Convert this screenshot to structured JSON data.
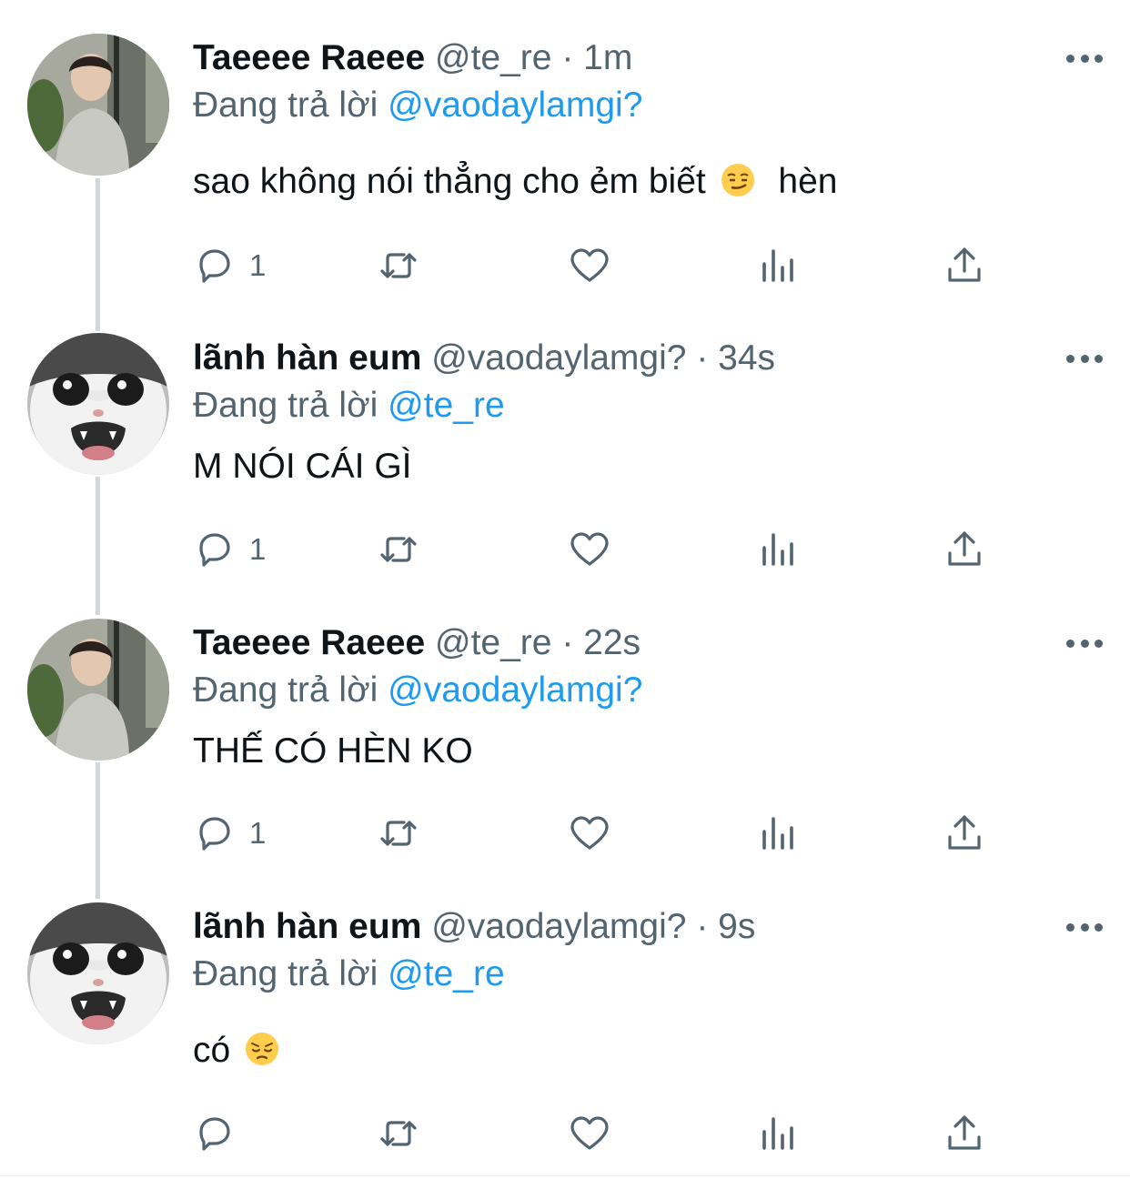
{
  "thread": [
    {
      "author_name": "Taeeee Raeee",
      "handle": "@te_re",
      "separator": "·",
      "time": "1m",
      "reply_prefix": "Đang trả lời",
      "reply_to": "@vaodaylamgi?",
      "text": "sao không nói thẳng cho ẻm biết",
      "text_suffix": "hèn",
      "emoji": "smirking-face-emoji",
      "reply_count": "1",
      "avatar": "person-photo-avatar"
    },
    {
      "author_name": "lãnh hàn eum",
      "handle": "@vaodaylamgi?",
      "separator": "·",
      "time": "34s",
      "reply_prefix": "Đang trả lời",
      "reply_to": "@te_re",
      "text": "M NÓI CÁI GÌ",
      "reply_count": "1",
      "avatar": "crying-cat-avatar"
    },
    {
      "author_name": "Taeeee Raeee",
      "handle": "@te_re",
      "separator": "·",
      "time": "22s",
      "reply_prefix": "Đang trả lời",
      "reply_to": "@vaodaylamgi?",
      "text": "THẾ CÓ HÈN KO",
      "reply_count": "1",
      "avatar": "person-photo-avatar"
    },
    {
      "author_name": "lãnh hàn eum",
      "handle": "@vaodaylamgi?",
      "separator": "·",
      "time": "9s",
      "reply_prefix": "Đang trả lời",
      "reply_to": "@te_re",
      "text": "có",
      "emoji": "pensive-face-emoji",
      "reply_count": "",
      "avatar": "crying-cat-avatar"
    }
  ],
  "icons": {
    "reply": "reply-icon",
    "retweet": "retweet-icon",
    "like": "heart-icon",
    "views": "views-chart-icon",
    "share": "share-icon",
    "more": "more-options-icon"
  },
  "colors": {
    "text_primary": "#0f1419",
    "text_secondary": "#536471",
    "mention": "#1d9bf0",
    "thread_line": "#cfd9de"
  }
}
